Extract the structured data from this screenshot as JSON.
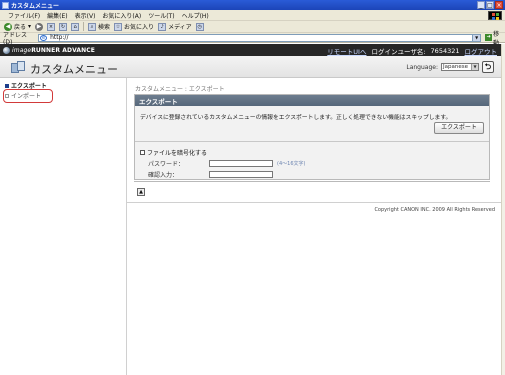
{
  "window": {
    "title": "カスタムメニュー",
    "buttons": [
      "_",
      "□",
      "×"
    ]
  },
  "menubar": {
    "items": [
      "ファイル(F)",
      "編集(E)",
      "表示(V)",
      "お気に入り(A)",
      "ツール(T)",
      "ヘルプ(H)"
    ]
  },
  "toolbar": {
    "back_label": "戻る",
    "search_label": "検索",
    "favorites_label": "お気に入り",
    "media_label": "メディア"
  },
  "addressbar": {
    "label": "アドレス(D)",
    "url": "http://",
    "go_label": "移動"
  },
  "rui": {
    "brand_prefix": "image",
    "brand_main": "RUNNER ADVANCE",
    "remote_top_link": "リモートUIへ",
    "login_user_label": "ログインユーザ名:",
    "login_user_value": "7654321",
    "logout_link": "ログアウト",
    "page_title": "カスタムメニュー",
    "language_label": "Language:",
    "language_value": "Japanese"
  },
  "leftnav": {
    "items": [
      {
        "label": "エクスポート",
        "active": true
      },
      {
        "label": "インポート",
        "active": false
      }
    ]
  },
  "main": {
    "breadcrumb": "カスタムメニュー : エクスポート",
    "panel_title": "エクスポート",
    "description": "デバイスに登録されているカスタムメニューの情報をエクスポートします。正しく処理できない機能はスキップします。",
    "export_button": "エクスポート",
    "encrypt_label": "ファイルを暗号化する",
    "password_label": "パスワード：",
    "password_value": "",
    "password_hint": "(4～16文字)",
    "confirm_label": "確認入力：",
    "confirm_value": "",
    "copyright": "Copyright CANON INC. 2009 All Rights Reserved"
  }
}
